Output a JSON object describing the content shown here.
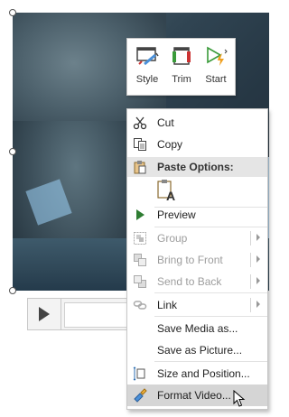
{
  "mini_toolbar": {
    "items": [
      {
        "label": "Style",
        "icon": "video-style-icon"
      },
      {
        "label": "Trim",
        "icon": "trim-video-icon"
      },
      {
        "label": "Start",
        "icon": "start-play-icon"
      }
    ]
  },
  "context_menu": {
    "cut": "Cut",
    "copy": "Copy",
    "paste_options": "Paste Options:",
    "preview": "Preview",
    "group": "Group",
    "bring_to_front": "Bring to Front",
    "send_to_back": "Send to Back",
    "link": "Link",
    "save_media_as": "Save Media as...",
    "save_as_picture": "Save as Picture...",
    "size_and_position": "Size and Position...",
    "format_video": "Format Video..."
  },
  "colors": {
    "menu_highlight": "#d5d5d5",
    "disabled_text": "#9d9d9d",
    "preview_icon": "#2e7d32"
  }
}
